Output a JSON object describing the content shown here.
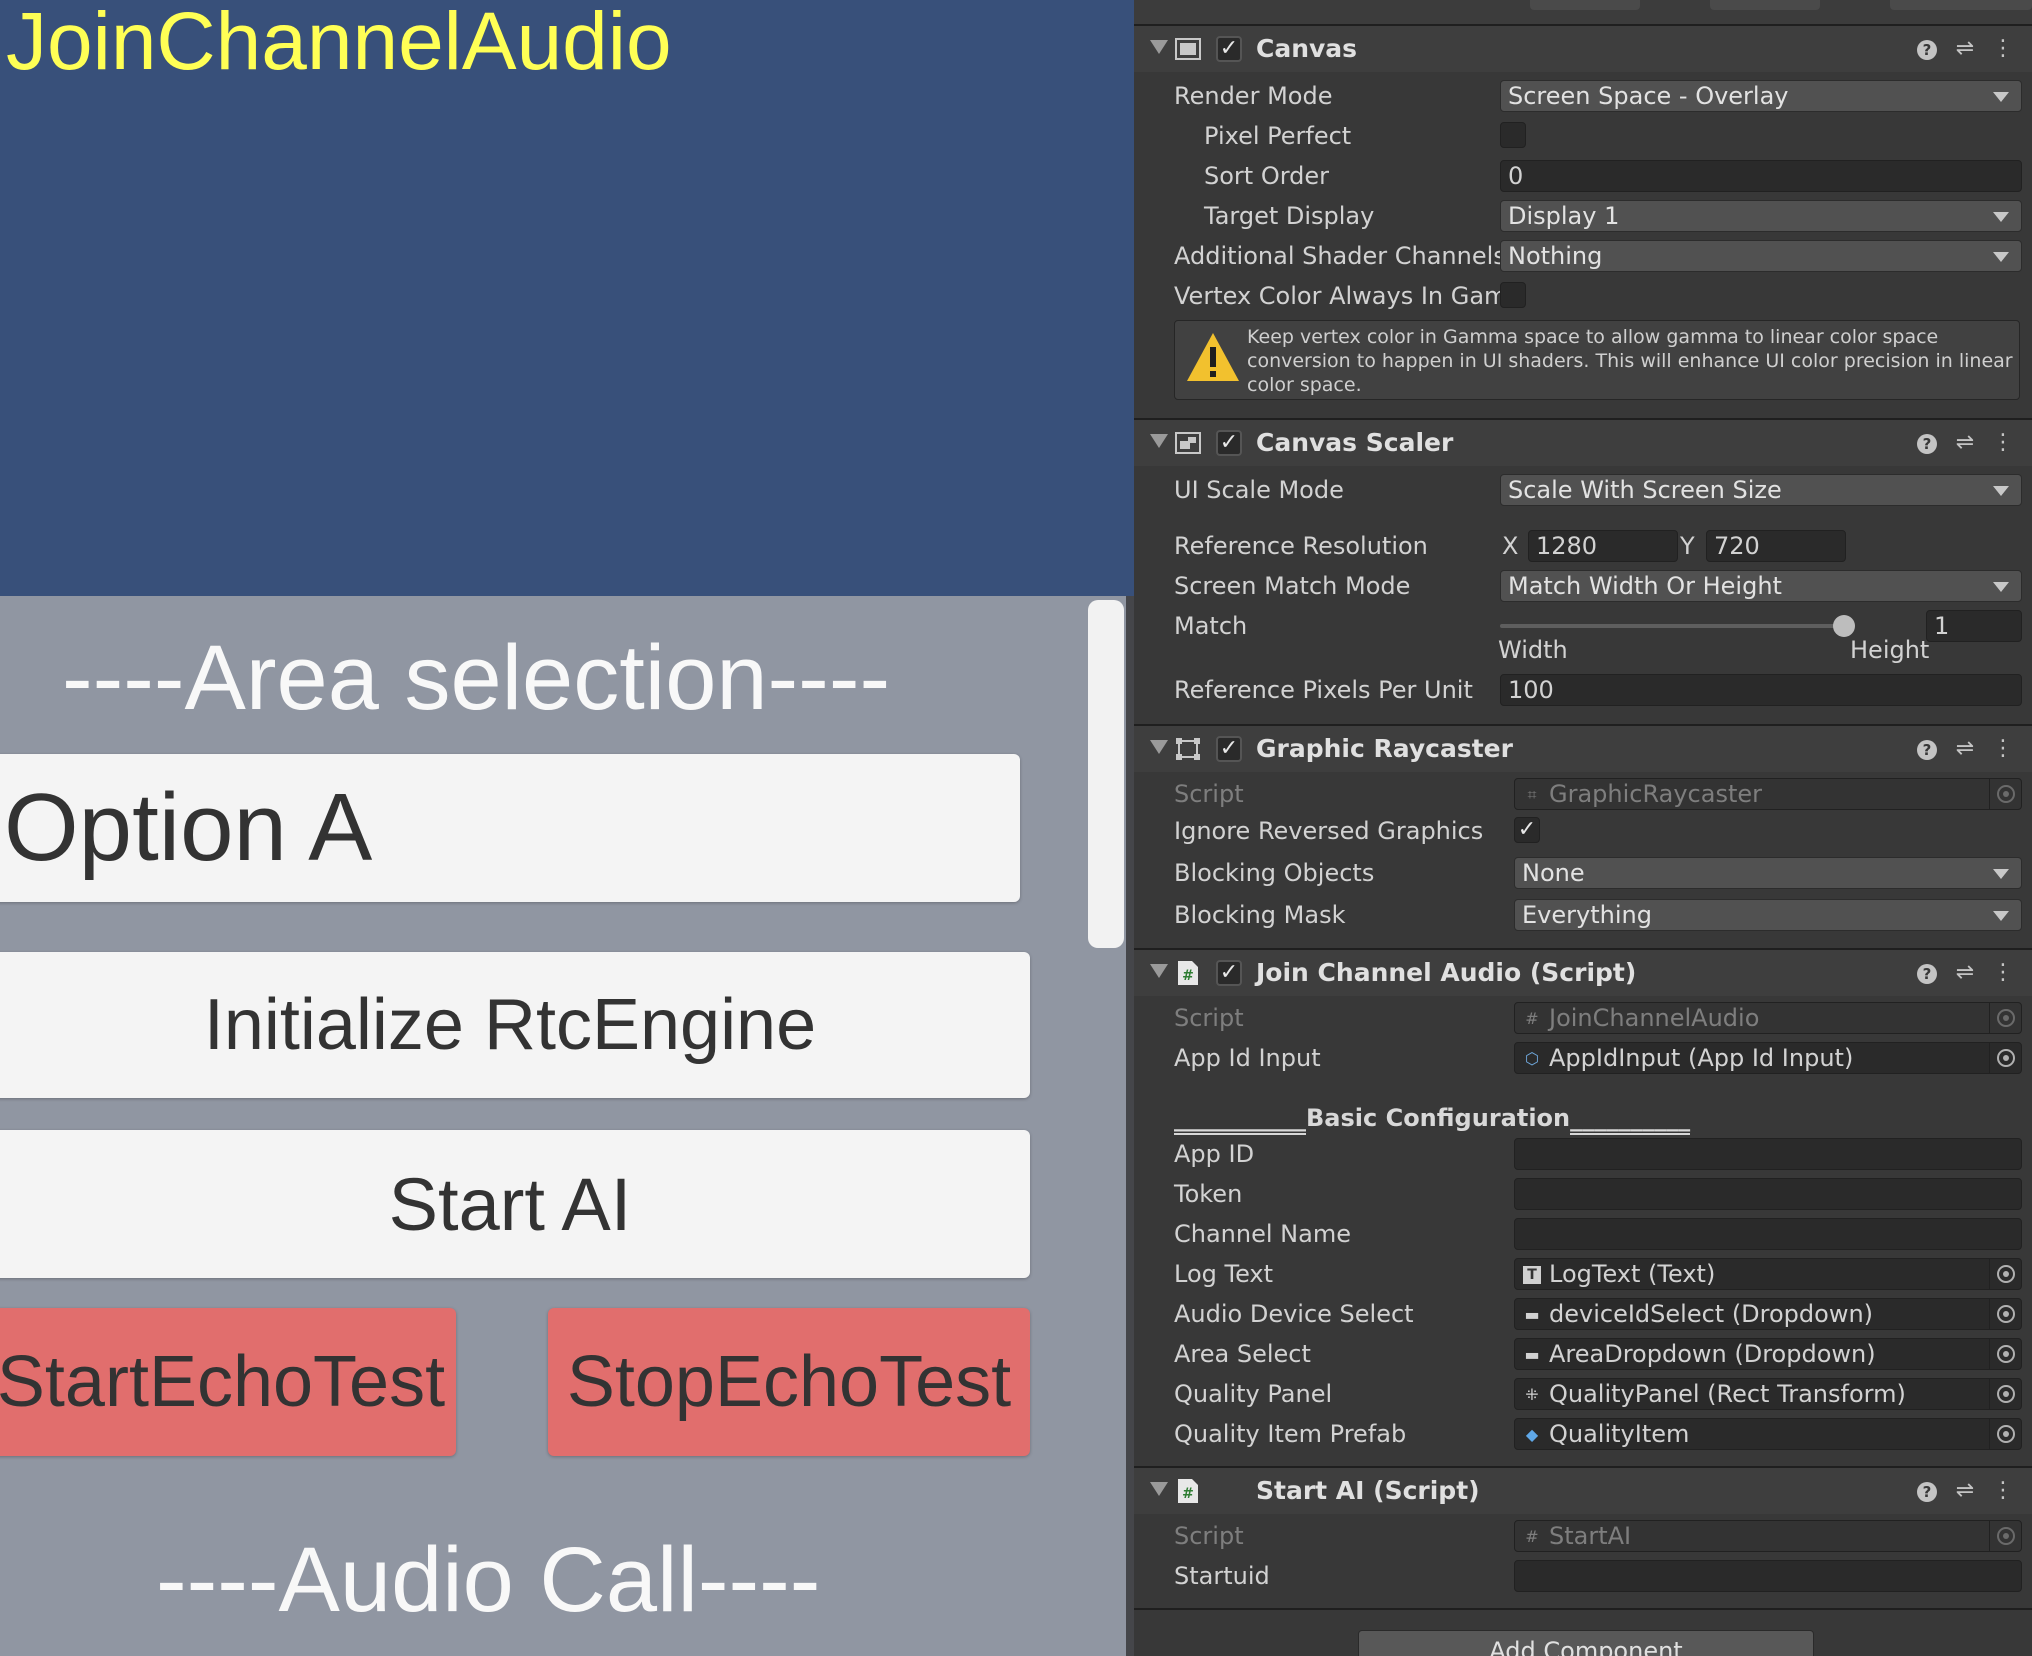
{
  "game": {
    "title": "JoinChannelAudio",
    "area_heading": "----Area selection----",
    "dropdown_value": "Option A",
    "init_button": "Initialize RtcEngine",
    "start_ai_button": "Start AI",
    "start_echo_button": "StartEchoTest",
    "stop_echo_button": "StopEchoTest",
    "audio_call_heading": "----Audio Call----",
    "colors": {
      "background": "#38507a",
      "panel": "#9096a2",
      "title": "#ffff55",
      "red_button": "#e16e6d"
    }
  },
  "inspector": {
    "canvas": {
      "title": "Canvas",
      "render_mode": {
        "label": "Render Mode",
        "value": "Screen Space - Overlay"
      },
      "pixel_perfect": {
        "label": "Pixel Perfect",
        "checked": false
      },
      "sort_order": {
        "label": "Sort Order",
        "value": "0"
      },
      "target_display": {
        "label": "Target Display",
        "value": "Display 1"
      },
      "shader_channels": {
        "label": "Additional Shader Channels",
        "value": "Nothing"
      },
      "vertex_gamma": {
        "label": "Vertex Color Always In Gamn",
        "checked": false
      },
      "help_text": "Keep vertex color in Gamma space to allow gamma to linear color space conversion to happen in UI shaders. This will enhance UI color precision in linear color space."
    },
    "canvas_scaler": {
      "title": "Canvas Scaler",
      "ui_scale_mode": {
        "label": "UI Scale Mode",
        "value": "Scale With Screen Size"
      },
      "reference_resolution": {
        "label": "Reference Resolution",
        "x_label": "X",
        "x": "1280",
        "y_label": "Y",
        "y": "720"
      },
      "screen_match_mode": {
        "label": "Screen Match Mode",
        "value": "Match Width Or Height"
      },
      "match": {
        "label": "Match",
        "value": "1",
        "fraction": 1,
        "left_label": "Width",
        "right_label": "Height"
      },
      "pixels_per_unit": {
        "label": "Reference Pixels Per Unit",
        "value": "100"
      }
    },
    "graphic_raycaster": {
      "title": "Graphic Raycaster",
      "script": {
        "label": "Script",
        "value": "GraphicRaycaster"
      },
      "ignore_reversed": {
        "label": "Ignore Reversed Graphics",
        "checked": true
      },
      "blocking_objects": {
        "label": "Blocking Objects",
        "value": "None"
      },
      "blocking_mask": {
        "label": "Blocking Mask",
        "value": "Everything"
      }
    },
    "join_channel_audio": {
      "title": "Join Channel Audio (Script)",
      "script": {
        "label": "Script",
        "value": "JoinChannelAudio"
      },
      "app_id_input": {
        "label": "App Id Input",
        "value": "AppIdInput (App Id Input)"
      },
      "section_prefix": "___________",
      "section_name": "Basic Configuration",
      "section_suffix": "__________",
      "app_id": {
        "label": "App ID",
        "value": ""
      },
      "token": {
        "label": "Token",
        "value": ""
      },
      "channel_name": {
        "label": "Channel Name",
        "value": ""
      },
      "log_text": {
        "label": "Log Text",
        "value": "LogText (Text)"
      },
      "audio_device_select": {
        "label": "Audio Device Select",
        "value": "deviceIdSelect (Dropdown)"
      },
      "area_select": {
        "label": "Area Select",
        "value": "AreaDropdown (Dropdown)"
      },
      "quality_panel": {
        "label": "Quality Panel",
        "value": "QualityPanel (Rect Transform)"
      },
      "quality_item_prefab": {
        "label": "Quality Item Prefab",
        "value": "QualityItem"
      }
    },
    "start_ai": {
      "title": "Start AI (Script)",
      "script": {
        "label": "Script",
        "value": "StartAI"
      },
      "startuid": {
        "label": "Startuid",
        "value": ""
      }
    },
    "add_component": "Add Component",
    "icons": {
      "help": "help-icon",
      "preset": "preset-sliders-icon",
      "menu": "kebab-menu-icon",
      "warning": "warning-icon",
      "object_picker": "object-picker-icon"
    }
  }
}
